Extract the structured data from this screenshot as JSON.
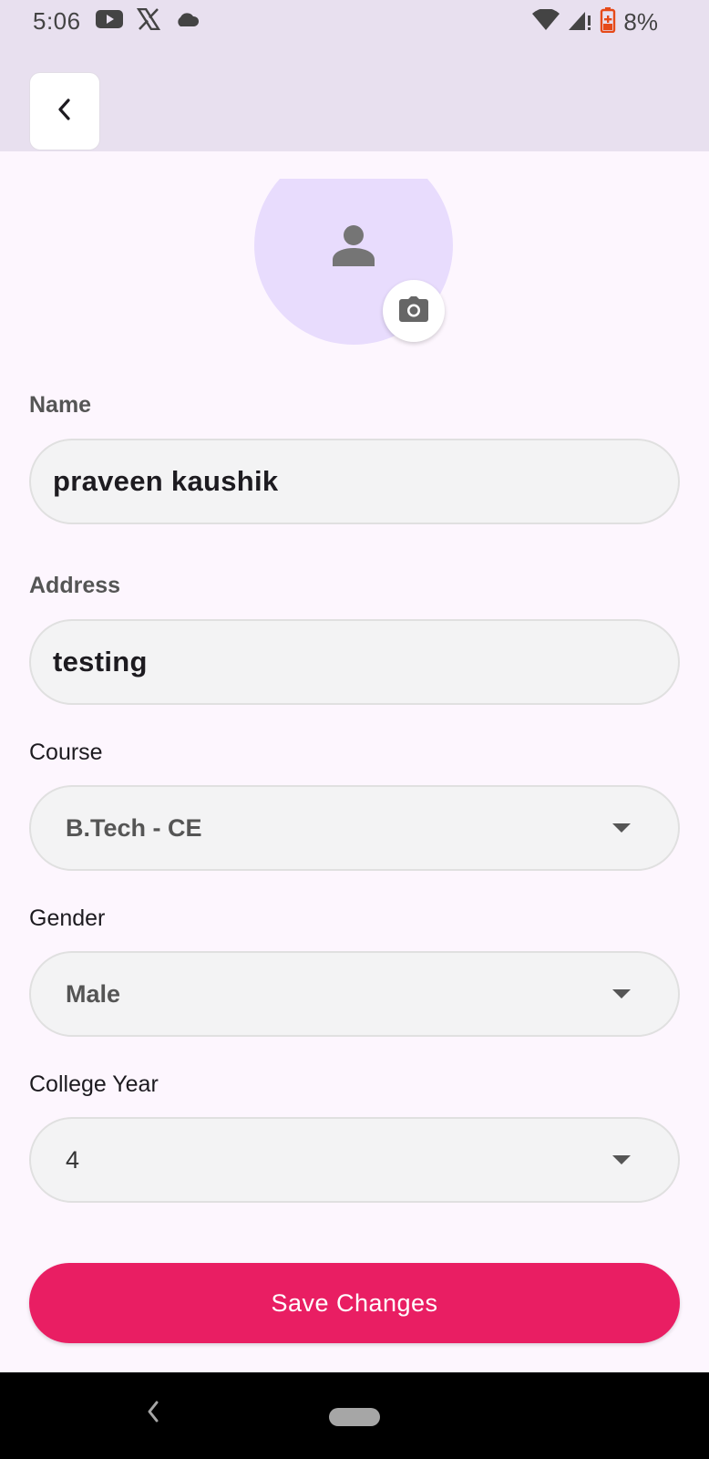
{
  "status_bar": {
    "time": "5:06",
    "battery": "8%",
    "icons_left": [
      "youtube-icon",
      "x-logo-icon",
      "cloud-icon"
    ],
    "icons_right": [
      "wifi-icon",
      "signal-icon",
      "battery-low-icon"
    ]
  },
  "header": {
    "back_icon": "chevron-left-icon"
  },
  "profile": {
    "avatar_icon": "person-icon",
    "camera_icon": "camera-icon"
  },
  "form": {
    "name": {
      "label": "Name",
      "value": "praveen kaushik"
    },
    "address": {
      "label": "Address",
      "value": "testing"
    },
    "course": {
      "label": "Course",
      "value": "B.Tech - CE"
    },
    "gender": {
      "label": "Gender",
      "value": "Male"
    },
    "college_year": {
      "label": "College Year",
      "value": "4"
    }
  },
  "actions": {
    "save_label": "Save Changes"
  },
  "colors": {
    "accent": "#e91e63",
    "app_bar": "#e8e0ef",
    "background": "#fdf6fe",
    "avatar_bg": "#e8dcfd"
  }
}
